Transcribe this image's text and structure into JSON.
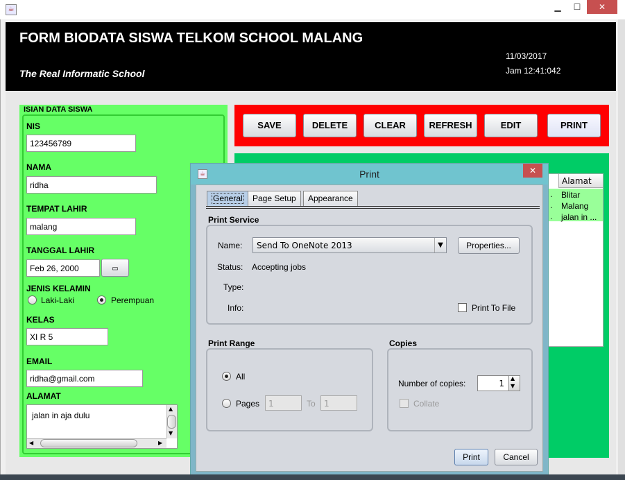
{
  "window": {
    "minimize": "▁",
    "maximize": "☐",
    "close": "✕",
    "app_icon": "java-icon"
  },
  "header": {
    "title": "FORM BIODATA SISWA TELKOM SCHOOL MALANG",
    "subtitle": "The Real Informatic School",
    "date": "11/03/2017",
    "time": "Jam 12:41:042"
  },
  "form": {
    "section_title": "ISIAN DATA SISWA",
    "nis_label": "NIS",
    "nis_value": "123456789",
    "nama_label": "NAMA",
    "nama_value": "ridha",
    "tempat_label": "TEMPAT LAHIR",
    "tempat_value": "malang",
    "tanggal_label": "TANGGAL LAHIR",
    "tanggal_value": "Feb 26, 2000",
    "gender_label": "JENIS KELAMIN",
    "gender_options": [
      "Laki-Laki",
      "Perempuan"
    ],
    "gender_selected": "Perempuan",
    "kelas_label": "KELAS",
    "kelas_value": "XI R 5",
    "email_label": "EMAIL",
    "email_value": "ridha@gmail.com",
    "alamat_label": "ALAMAT",
    "alamat_value": "jalan in aja dulu"
  },
  "actions": [
    "SAVE",
    "DELETE",
    "CLEAR",
    "REFRESH",
    "EDIT",
    "PRINT"
  ],
  "table": {
    "header": "Alamat",
    "rows": [
      "Blitar",
      "Malang",
      "jalan in ..."
    ]
  },
  "print_dialog": {
    "title": "Print",
    "tabs": [
      "General",
      "Page Setup",
      "Appearance"
    ],
    "active_tab": "General",
    "service_title": "Print Service",
    "name_label": "Name:",
    "name_value": "Send To OneNote 2013",
    "properties_btn": "Properties...",
    "status_label": "Status:",
    "status_value": "Accepting jobs",
    "type_label": "Type:",
    "info_label": "Info:",
    "print_to_file": "Print To File",
    "range_title": "Print Range",
    "range_all": "All",
    "range_pages": "Pages",
    "pages_from": "1",
    "pages_to_label": "To",
    "pages_to": "1",
    "copies_title": "Copies",
    "copies_label": "Number of copies:",
    "copies_value": "1",
    "collate": "Collate",
    "print_btn": "Print",
    "cancel_btn": "Cancel"
  }
}
